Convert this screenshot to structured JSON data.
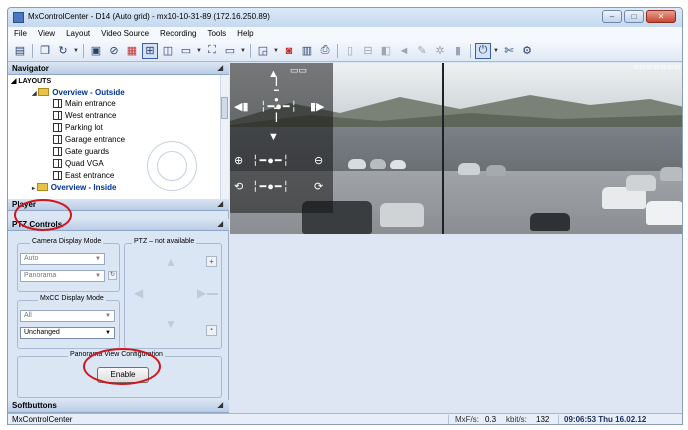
{
  "window": {
    "title": "MxControlCenter - D14 (Auto grid) - mx10-10-31-89 (172.16.250.89)",
    "buttons": {
      "minimize": "–",
      "maximize": "□",
      "close": "✕"
    }
  },
  "menu": [
    "File",
    "View",
    "Layout",
    "Video Source",
    "Recording",
    "Tools",
    "Help"
  ],
  "toolbar": {
    "icons": [
      "save-icon",
      "copy-icon",
      "refresh-icon",
      "image-icon",
      "link-icon",
      "layout-red-icon",
      "grid-icon",
      "tag-icon",
      "window-icon",
      "fullscreen-icon",
      "monitor-icon",
      "camera-play-icon",
      "recording-icon",
      "calendar-icon",
      "print-icon",
      "empty-icon",
      "table-icon",
      "split-icon",
      "speaker-icon",
      "mic-icon",
      "light-icon",
      "bulb-icon",
      "power-icon",
      "wrench-icon",
      "settings-icon"
    ]
  },
  "navigator": {
    "title": "Navigator",
    "section": "LAYOUTS",
    "group": "Overview - Outside",
    "items": [
      "Main entrance",
      "West entrance",
      "Parking lot",
      "Garage entrance",
      "Gate guards",
      "Quad VGA",
      "East entrance"
    ],
    "next_group": "Overview - Inside"
  },
  "player": {
    "title": "Player"
  },
  "ptz": {
    "title": "PTZ Controls",
    "camera_display_mode": {
      "label": "Camera Display Mode",
      "value1": "Auto",
      "value2": "Panorama"
    },
    "mxcc_display_mode": {
      "label": "MxCC Display Mode",
      "value1": "All",
      "value2": "Unchanged"
    },
    "ptz_status": "PTZ – not available",
    "plus": "+",
    "minus": "−",
    "panorama_label": "Panorama View Configuration",
    "enable_button": "Enable"
  },
  "softbuttons": {
    "title": "Softbuttons"
  },
  "video": {
    "timestamp": "2012-02-16 09:06:53"
  },
  "status": {
    "app": "MxControlCenter",
    "mbf_label": "MxF/s:",
    "mbf_value": "0.3",
    "kbit_label": "kbit/s:",
    "kbit_value": "132",
    "datetime": "09:06:53 Thu 16.02.12"
  },
  "colors": {
    "accent": "#3a5da8",
    "highlight_ring": "#d2141c"
  }
}
